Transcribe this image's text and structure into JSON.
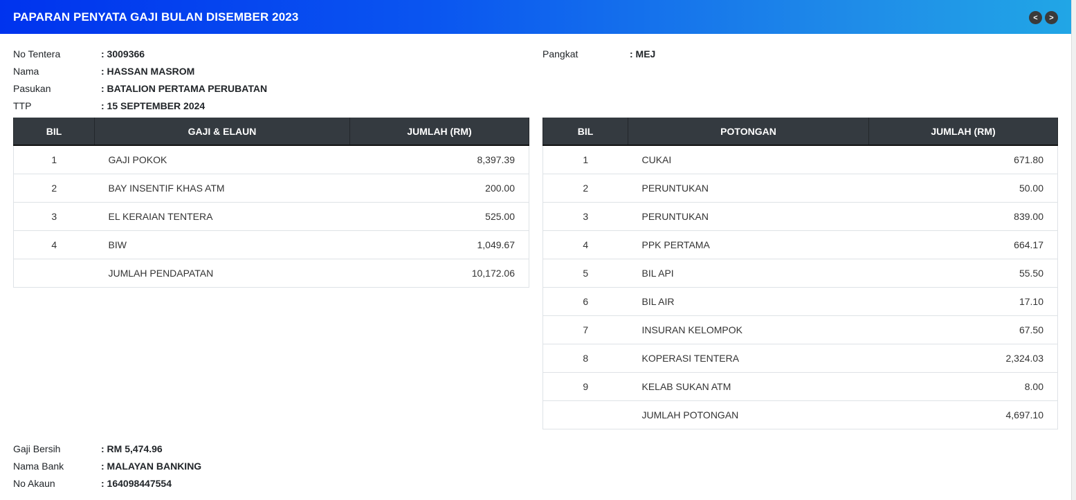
{
  "header": {
    "title": "PAPARAN PENYATA GAJI BULAN DISEMBER 2023",
    "prev_label": "<",
    "next_label": ">"
  },
  "profile": {
    "no_tentera": {
      "label": "No Tentera",
      "value": ": 3009366"
    },
    "nama": {
      "label": "Nama",
      "value": ": HASSAN MASROM"
    },
    "pasukan": {
      "label": "Pasukan",
      "value": ": BATALION PERTAMA PERUBATAN"
    },
    "ttp": {
      "label": "TTP",
      "value": ": 15 SEPTEMBER 2024"
    },
    "pangkat": {
      "label": "Pangkat",
      "value": ": MEJ"
    }
  },
  "earnings": {
    "headers": [
      "BIL",
      "GAJI & ELAUN",
      "JUMLAH (RM)"
    ],
    "rows": [
      {
        "bil": "1",
        "name": "GAJI POKOK",
        "amount": "8,397.39"
      },
      {
        "bil": "2",
        "name": "BAY INSENTIF KHAS ATM",
        "amount": "200.00"
      },
      {
        "bil": "3",
        "name": "EL KERAIAN TENTERA",
        "amount": "525.00"
      },
      {
        "bil": "4",
        "name": "BIW",
        "amount": "1,049.67"
      },
      {
        "bil": "",
        "name": "JUMLAH PENDAPATAN",
        "amount": "10,172.06"
      }
    ]
  },
  "deductions": {
    "headers": [
      "BIL",
      "POTONGAN",
      "JUMLAH (RM)"
    ],
    "rows": [
      {
        "bil": "1",
        "name": "CUKAI",
        "amount": "671.80"
      },
      {
        "bil": "2",
        "name": "PERUNTUKAN",
        "amount": "50.00"
      },
      {
        "bil": "3",
        "name": "PERUNTUKAN",
        "amount": "839.00"
      },
      {
        "bil": "4",
        "name": "PPK PERTAMA",
        "amount": "664.17"
      },
      {
        "bil": "5",
        "name": "BIL API",
        "amount": "55.50"
      },
      {
        "bil": "6",
        "name": "BIL AIR",
        "amount": "17.10"
      },
      {
        "bil": "7",
        "name": "INSURAN KELOMPOK",
        "amount": "67.50"
      },
      {
        "bil": "8",
        "name": "KOPERASI TENTERA",
        "amount": "2,324.03"
      },
      {
        "bil": "9",
        "name": "KELAB SUKAN ATM",
        "amount": "8.00"
      },
      {
        "bil": "",
        "name": "JUMLAH POTONGAN",
        "amount": "4,697.10"
      }
    ]
  },
  "summary": {
    "gaji_bersih": {
      "label": "Gaji Bersih",
      "value": ": RM 5,474.96"
    },
    "nama_bank": {
      "label": "Nama Bank",
      "value": ": MALAYAN BANKING"
    },
    "no_akaun": {
      "label": "No Akaun",
      "value": ": 164098447554"
    }
  }
}
